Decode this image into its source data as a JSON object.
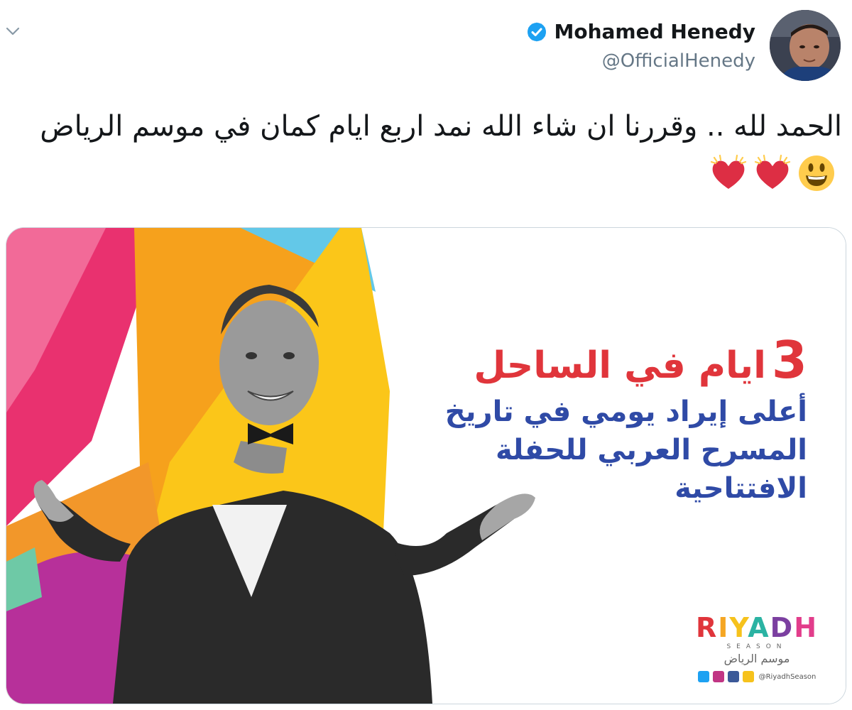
{
  "tweet": {
    "display_name": "Mohamed Henedy",
    "handle": "@OfficialHenedy",
    "text": "الحمد لله .. وقررنا ان شاء الله نمد اربع ايام كمان في موسم الرياض",
    "emojis": [
      "smiley-emoji",
      "beating-heart-emoji",
      "beating-heart-emoji"
    ]
  },
  "media": {
    "promo_number": "3",
    "promo_title": "ايام في الساحل",
    "promo_body_lines": [
      "أعلى إيراد يومي في تاريخ",
      "المسرح العربي للحفلة",
      "الافتتاحية"
    ],
    "brand": {
      "word_letters": [
        "R",
        "I",
        "Y",
        "A",
        "D",
        "H"
      ],
      "word_colors": [
        "#e0353b",
        "#f5a623",
        "#f6c21c",
        "#2bb3a3",
        "#7b3fa0",
        "#e23d8b"
      ],
      "sub": "SEASON",
      "arabic": "موسم الرياض",
      "social_handle": "@RiyadhSeason"
    }
  },
  "colors": {
    "verified": "#1da1f2",
    "text_primary": "#14171a",
    "text_secondary": "#657786",
    "headline_red": "#e0353b",
    "body_blue": "#2f4aa6"
  }
}
